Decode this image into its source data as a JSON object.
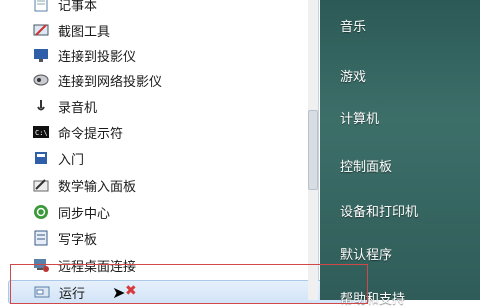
{
  "programs": [
    {
      "label": "记事本",
      "icon": "notepad-icon"
    },
    {
      "label": "截图工具",
      "icon": "snipping-tool-icon"
    },
    {
      "label": "连接到投影仪",
      "icon": "projector-icon"
    },
    {
      "label": "连接到网络投影仪",
      "icon": "network-projector-icon"
    },
    {
      "label": "录音机",
      "icon": "microphone-icon"
    },
    {
      "label": "命令提示符",
      "icon": "command-prompt-icon"
    },
    {
      "label": "入门",
      "icon": "getting-started-icon"
    },
    {
      "label": "数学输入面板",
      "icon": "math-input-icon"
    },
    {
      "label": "同步中心",
      "icon": "sync-center-icon"
    },
    {
      "label": "写字板",
      "icon": "wordpad-icon"
    },
    {
      "label": "远程桌面连接",
      "icon": "remote-desktop-icon"
    },
    {
      "label": "运行",
      "icon": "run-icon"
    }
  ],
  "right_menu": [
    {
      "label": "音乐"
    },
    {
      "label": "游戏"
    },
    {
      "label": "计算机"
    },
    {
      "label": "控制面板"
    },
    {
      "label": "设备和打印机"
    },
    {
      "label": "默认程序"
    },
    {
      "label": "帮助和支持"
    }
  ],
  "colors": {
    "right_panel": "#3d6f69",
    "highlight_box": "#d04848"
  }
}
